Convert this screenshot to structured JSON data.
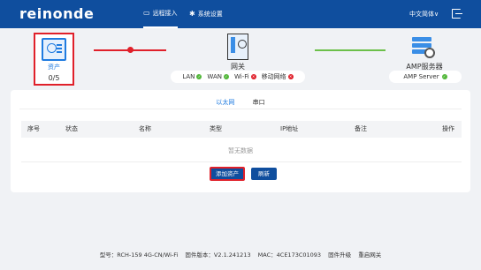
{
  "header": {
    "logo": "reinonde",
    "nav": [
      {
        "label": "远程接入",
        "icon": "monitor-icon",
        "active": true
      },
      {
        "label": "系统设置",
        "icon": "gear-icon",
        "active": false
      }
    ],
    "language": "中文简体∨"
  },
  "topology": {
    "asset": {
      "label": "资产",
      "count": "0/5"
    },
    "gateway": {
      "label": "网关",
      "statuses": [
        {
          "name": "LAN",
          "ok": true
        },
        {
          "name": "WAN",
          "ok": true
        },
        {
          "name": "Wi-Fi",
          "ok": false
        },
        {
          "name": "移动网络",
          "ok": false
        }
      ]
    },
    "server": {
      "label": "AMP服务器",
      "status": {
        "name": "AMP Server",
        "ok": true
      }
    }
  },
  "panel": {
    "tabs": [
      "以太网",
      "串口"
    ],
    "active_tab": 0,
    "columns": [
      "序号",
      "状态",
      "名称",
      "类型",
      "IP地址",
      "备注",
      "操作"
    ],
    "empty_text": "暂无数据",
    "add_button": "添加资产",
    "refresh_button": "刷新"
  },
  "footer": {
    "model": "型号：RCH-159 4G-CN/Wi-Fi",
    "firmware": "固件版本：V2.1.241213",
    "mac": "MAC：4CE173C01093",
    "upgrade": "固件升级",
    "reboot": "重启网关"
  },
  "colors": {
    "header": "#0f4e9e",
    "accent": "#1f7be0",
    "error": "#e0202a",
    "ok": "#52b73a"
  }
}
